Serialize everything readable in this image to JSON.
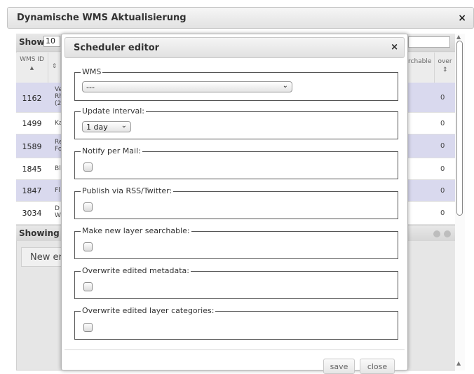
{
  "outer": {
    "title": "Dynamische WMS Aktualisierung",
    "close_glyph": "×"
  },
  "table": {
    "show_label": "Show",
    "show_value": "10",
    "headers": {
      "wms_id": "WMS ID",
      "searchable": "rchable",
      "overwrite": "over"
    },
    "rows": [
      {
        "id": "1162",
        "title": "Ve\nRh\n(2",
        "count": "0"
      },
      {
        "id": "1499",
        "title": "Ka",
        "count": "0"
      },
      {
        "id": "1589",
        "title": "Re\nFo",
        "count": "0"
      },
      {
        "id": "1845",
        "title": "Bl",
        "count": "0"
      },
      {
        "id": "1847",
        "title": "Fl",
        "count": "0"
      },
      {
        "id": "3034",
        "title": "D\nW",
        "count": "0"
      }
    ],
    "footer": "Showing 1",
    "new_entry_label": "New er"
  },
  "modal": {
    "title": "Scheduler editor",
    "close_glyph": "×",
    "fields": {
      "wms": {
        "legend": "WMS",
        "value": "---"
      },
      "interval": {
        "legend": "Update interval:",
        "value": "1 day"
      },
      "notify": {
        "legend": "Notify per Mail:"
      },
      "publish": {
        "legend": "Publish via RSS/Twitter:"
      },
      "searchable": {
        "legend": "Make new layer searchable:"
      },
      "metadata": {
        "legend": "Overwrite edited metadata:"
      },
      "categories": {
        "legend": "Overwrite edited layer categories:"
      }
    },
    "save_label": "save",
    "close_label": "close"
  },
  "icons": {
    "sort_asc": "▲",
    "sort_both": "⇕",
    "dropdown": "⌄"
  },
  "colors": {
    "row_highlight": "#d9d9ee"
  }
}
